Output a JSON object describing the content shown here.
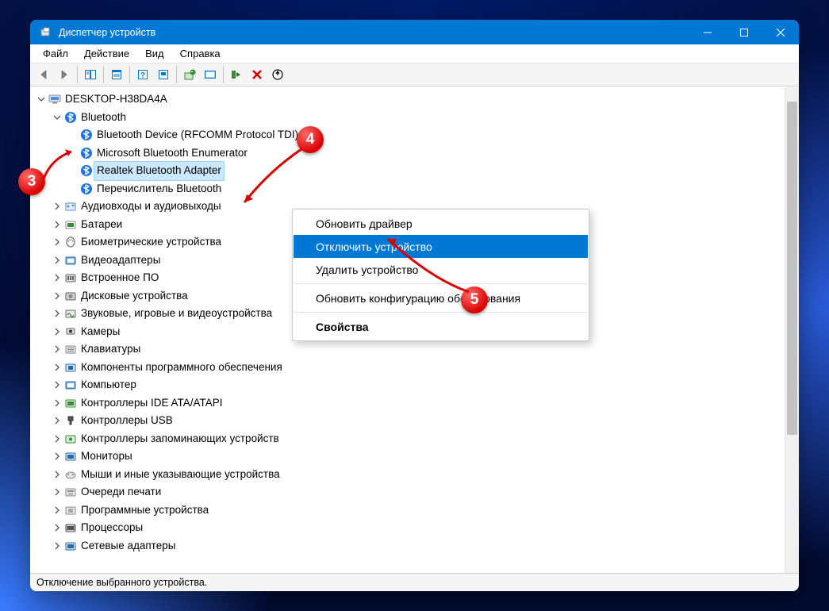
{
  "title": "Диспетчер устройств",
  "menus": {
    "file": "Файл",
    "action": "Действие",
    "view": "Вид",
    "help": "Справка"
  },
  "status": "Отключение выбранного устройства.",
  "root": "DESKTOP-H38DA4A",
  "bluetooth": {
    "label": "Bluetooth",
    "children": [
      "Bluetooth Device (RFCOMM Protocol TDI)",
      "Microsoft Bluetooth Enumerator",
      "Realtek Bluetooth Adapter",
      "Перечислитель Bluetooth"
    ]
  },
  "categories": [
    "Аудиовходы и аудиовыходы",
    "Батареи",
    "Биометрические устройства",
    "Видеоадаптеры",
    "Встроенное ПО",
    "Дисковые устройства",
    "Звуковые, игровые и видеоустройства",
    "Камеры",
    "Клавиатуры",
    "Компоненты программного обеспечения",
    "Компьютер",
    "Контроллеры IDE ATA/ATAPI",
    "Контроллеры USB",
    "Контроллеры запоминающих устройств",
    "Мониторы",
    "Мыши и иные указывающие устройства",
    "Очереди печати",
    "Программные устройства",
    "Процессоры",
    "Сетевые адаптеры"
  ],
  "context_menu": {
    "update": "Обновить драйвер",
    "disable": "Отключить устройство",
    "uninstall": "Удалить устройство",
    "scan": "Обновить конфигурацию оборудования",
    "props": "Свойства"
  },
  "callouts": {
    "c3": "3",
    "c4": "4",
    "c5": "5"
  }
}
